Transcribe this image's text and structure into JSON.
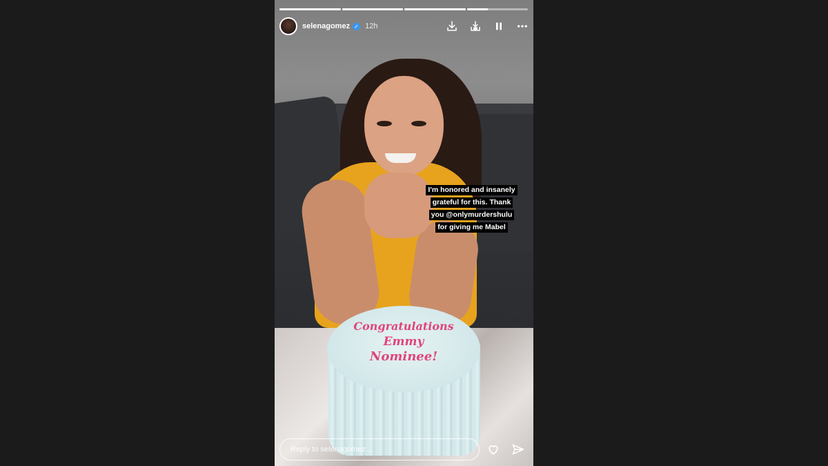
{
  "story": {
    "username": "selenagomez",
    "verified_icon": "verified-badge-icon",
    "time": "12h",
    "progress": [
      1,
      1,
      1,
      0.35
    ],
    "caption_lines": [
      "I'm honored and insanely",
      "grateful for this. Thank",
      "you @onlymurdershulu",
      "for giving me Mabel"
    ],
    "cake_lines": [
      "Congratulations",
      "Emmy",
      "Nominee!"
    ],
    "reply_placeholder": "Reply to selenagomez...",
    "icons": {
      "download": "download-icon",
      "add_to_story": "add-to-story-icon",
      "pause": "pause-icon",
      "more": "more-options-icon",
      "like": "heart-icon",
      "share": "send-icon"
    }
  }
}
